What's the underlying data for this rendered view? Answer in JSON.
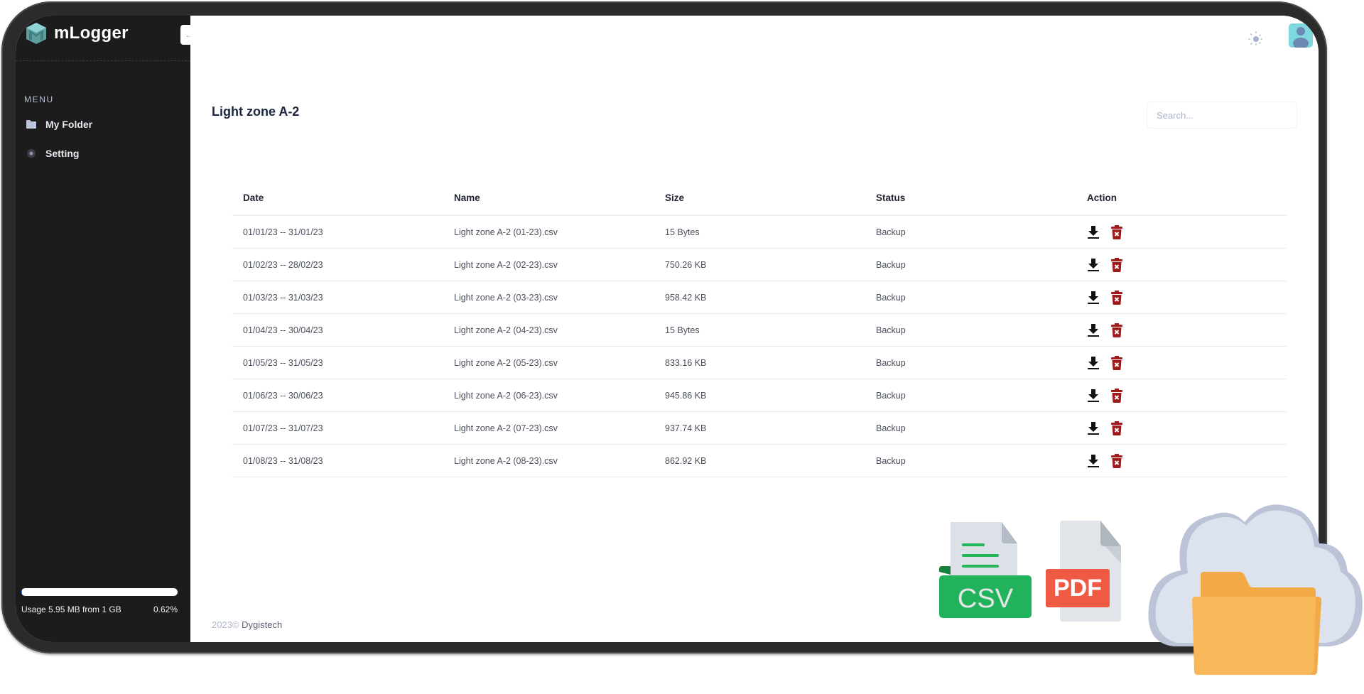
{
  "app": {
    "name": "mLogger"
  },
  "sidebar": {
    "menu_label": "MENU",
    "items": [
      {
        "label": "My Folder",
        "icon": "folder-icon"
      },
      {
        "label": "Setting",
        "icon": "gear-icon"
      }
    ],
    "usage": {
      "text": "Usage 5.95 MB from 1 GB",
      "percent_label": "0.62%",
      "percent": 0.62
    }
  },
  "header": {
    "collapse_icon": "arrow-left-icon",
    "theme_icon": "sun-icon",
    "avatar_icon": "user-icon"
  },
  "page": {
    "title": "Light zone A-2",
    "search_placeholder": "Search..."
  },
  "table": {
    "columns": [
      "Date",
      "Name",
      "Size",
      "Status",
      "Action"
    ],
    "rows": [
      {
        "date": "01/01/23 -- 31/01/23",
        "name": "Light zone A-2 (01-23).csv",
        "size": "15 Bytes",
        "status": "Backup"
      },
      {
        "date": "01/02/23 -- 28/02/23",
        "name": "Light zone A-2 (02-23).csv",
        "size": "750.26 KB",
        "status": "Backup"
      },
      {
        "date": "01/03/23 -- 31/03/23",
        "name": "Light zone A-2 (03-23).csv",
        "size": "958.42 KB",
        "status": "Backup"
      },
      {
        "date": "01/04/23 -- 30/04/23",
        "name": "Light zone A-2 (04-23).csv",
        "size": "15 Bytes",
        "status": "Backup"
      },
      {
        "date": "01/05/23 -- 31/05/23",
        "name": "Light zone A-2 (05-23).csv",
        "size": "833.16 KB",
        "status": "Backup"
      },
      {
        "date": "01/06/23 -- 30/06/23",
        "name": "Light zone A-2 (06-23).csv",
        "size": "945.86 KB",
        "status": "Backup"
      },
      {
        "date": "01/07/23 -- 31/07/23",
        "name": "Light zone A-2 (07-23).csv",
        "size": "937.74 KB",
        "status": "Backup"
      },
      {
        "date": "01/08/23 -- 31/08/23",
        "name": "Light zone A-2 (08-23).csv",
        "size": "862.92 KB",
        "status": "Backup"
      }
    ],
    "actions": {
      "download_icon": "download-icon",
      "delete_icon": "trash-icon"
    }
  },
  "footer": {
    "year": "2023©",
    "brand": "Dygistech"
  },
  "illustration": {
    "csv_label": "CSV",
    "pdf_label": "PDF"
  },
  "colors": {
    "sidebar_bg": "#1c1c1c",
    "delete_red": "#a01a1a",
    "csv_green": "#21b35b",
    "pdf_red": "#ef5a45",
    "folder_orange": "#f8b85a",
    "cloud": "#dde3ee"
  }
}
